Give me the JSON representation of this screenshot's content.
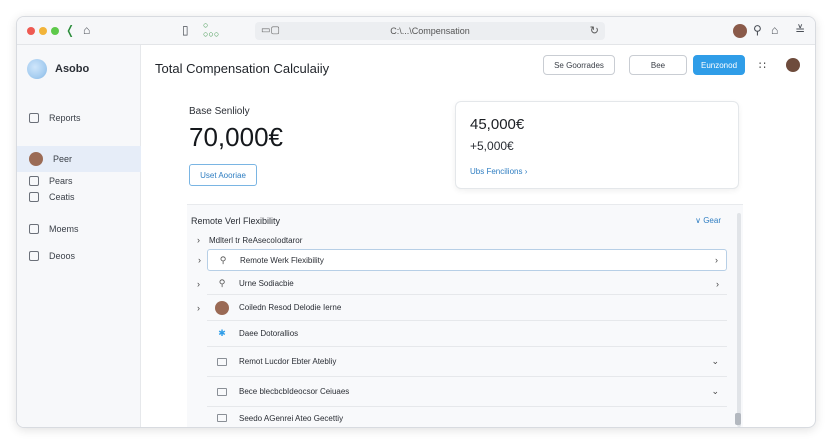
{
  "browser": {
    "url": "C:\\...\\Compensation",
    "tab_label": "○\n○○○"
  },
  "sidebar": {
    "brand": "Asobo",
    "items": [
      {
        "label": "Reports",
        "icon": "folder-icon"
      },
      {
        "label": "Peer",
        "icon": "avatar"
      },
      {
        "label": "Pears",
        "icon": "document-icon"
      },
      {
        "label": "Ceatis",
        "icon": "grid-icon"
      },
      {
        "label": "Moems",
        "icon": "folder-icon"
      },
      {
        "label": "Deoos",
        "icon": "folder-icon"
      }
    ]
  },
  "header": {
    "title": "Total Compensation Calculaiiy",
    "btn_outline_1": "Se Goorrades",
    "btn_outline_2": "Bee",
    "btn_primary": "Eunzonod"
  },
  "salary": {
    "label": "Base Senlioly",
    "value": "70,000€",
    "edit_label": "Uset Aooriae"
  },
  "card": {
    "value_primary": "45,000€",
    "value_secondary": "+5,000€",
    "link": "Ubs Fencilions"
  },
  "panel": {
    "title": "Remote Verl Flexibility",
    "toggle": "∨ Gear",
    "rows": [
      {
        "label": "Mdlterl tr ReAsecoIodtaror"
      },
      {
        "label": "Remote Werk Flexibility"
      },
      {
        "label": "Urne Sodiacbie"
      },
      {
        "label": "Coiledn Resod Delodie Ierne"
      },
      {
        "label": "Daee Dotorallios"
      },
      {
        "label": "Remot Lucdor Ebter Atebliy"
      },
      {
        "label": "Bece blecbcbIdeocsor Ceiuaes"
      },
      {
        "label": "Seedo AGenrei Ateo Gecettiy"
      }
    ]
  }
}
